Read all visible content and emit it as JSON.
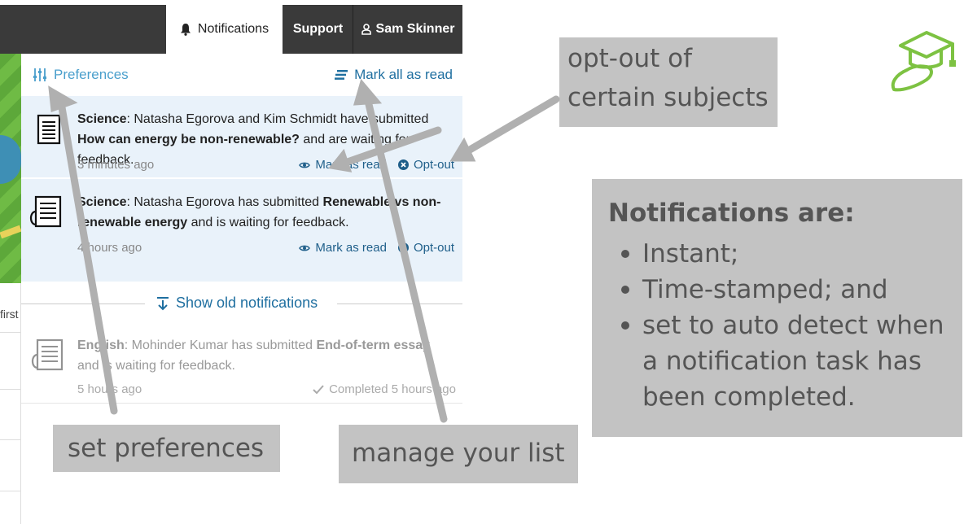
{
  "topbar": {
    "notifications_label": "Notifications",
    "support_label": "Support",
    "user_label": "Sam Skinner"
  },
  "left_fragment": "first",
  "panel": {
    "preferences_label": "Preferences",
    "mark_all_label": "Mark all as read",
    "notifications": [
      {
        "subject": "Science",
        "text_before": ": Natasha Egorova and Kim Schmidt have submitted ",
        "title": "How can energy be non-renewable?",
        "text_after": " and are waiting for feedback.",
        "time": "3 minutes ago",
        "mark_read_label": "Mark as read",
        "opt_out_label": "Opt-out"
      },
      {
        "subject": "Science",
        "text_before": ": Natasha Egorova has submitted ",
        "title": "Renewable vs non-renewable energy",
        "text_after": " and is waiting for feedback.",
        "time": "4 hours ago",
        "mark_read_label": "Mark as read",
        "opt_out_label": "Opt-out"
      }
    ],
    "show_old_label": "Show old notifications",
    "old_notification": {
      "subject": "English",
      "text_before": ": Mohinder Kumar has submitted ",
      "title": "End-of-term essay",
      "text_after": " and is waiting for feedback.",
      "time": "5 hours ago",
      "completed_label": "Completed 5 hours ago"
    }
  },
  "callouts": {
    "opt_out_line1": "opt-out of",
    "opt_out_line2": "certain subjects",
    "set_preferences": "set preferences",
    "manage_list": "manage your list",
    "info_title": "Notifications are:",
    "info_items": [
      "Instant;",
      "Time-stamped; and",
      "set to auto detect when a notification task has been completed."
    ]
  },
  "colors": {
    "accent_blue": "#1f6fa0",
    "light_blue": "#4a9fcc",
    "topbar_dark": "#3a3a3a",
    "highlight_bg": "#e9f2fa",
    "callout_gray": "#c3c3c3",
    "logo_green": "#7dc242"
  },
  "icons": {
    "notifications": "bell-icon",
    "user": "user-icon",
    "preferences": "sliders-icon",
    "mark_all": "list-icon",
    "mark_read": "eye-icon",
    "opt_out": "circle-x-icon",
    "show_old": "download-arrow-icon",
    "completed": "checkmark-icon",
    "document": "document-icon",
    "logo": "graduation-cap-icon"
  }
}
